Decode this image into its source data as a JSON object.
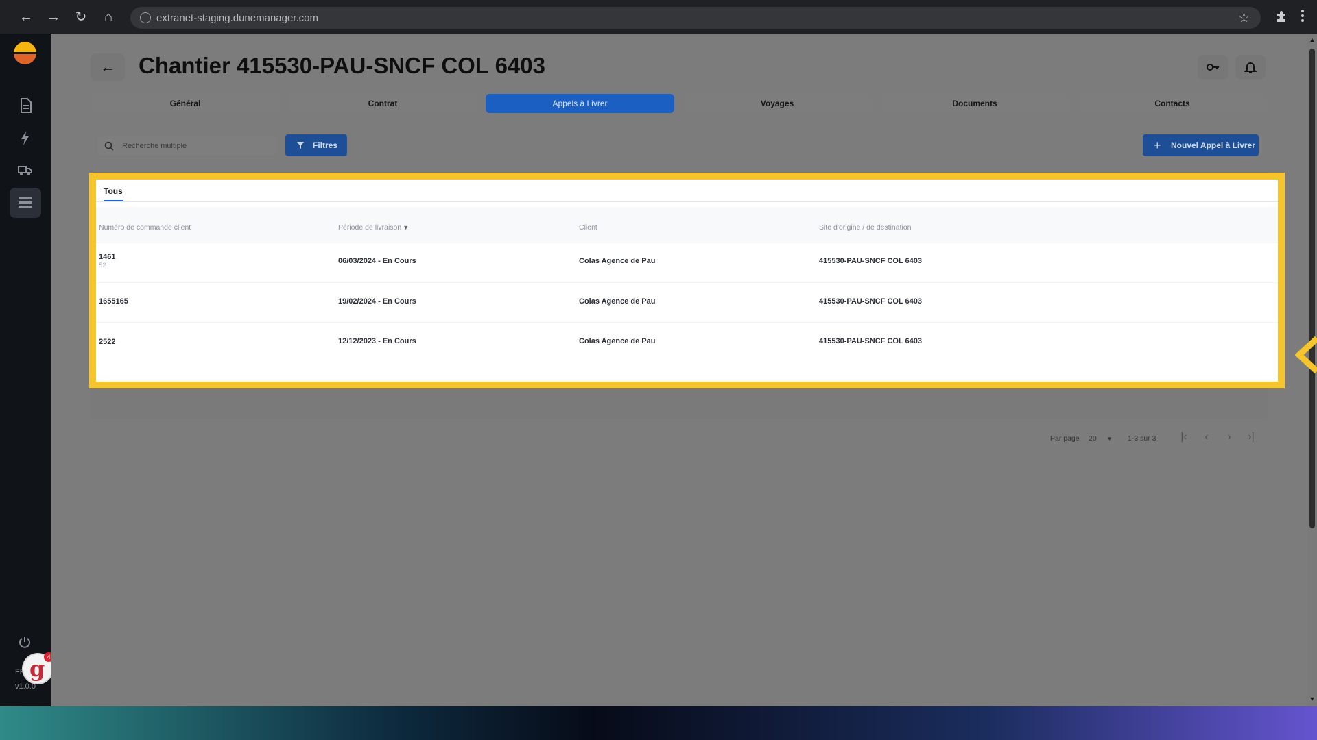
{
  "browser": {
    "url": "extranet-staging.dunemanager.com"
  },
  "sidebar": {
    "items": [
      {
        "name": "document-icon"
      },
      {
        "name": "lightning-icon"
      },
      {
        "name": "truck-icon"
      },
      {
        "name": "list-icon"
      }
    ],
    "footer_label": "FR",
    "version": "v1.0.0",
    "badge_count": "4"
  },
  "header": {
    "title": "Chantier 415530-PAU-SNCF COL 6403"
  },
  "tabs": [
    {
      "label": "Général"
    },
    {
      "label": "Contrat"
    },
    {
      "label": "Appels à Livrer"
    },
    {
      "label": "Voyages"
    },
    {
      "label": "Documents"
    },
    {
      "label": "Contacts"
    }
  ],
  "toolbar": {
    "search_placeholder": "Recherche multiple",
    "filter_label": "Filtres",
    "new_label": "Nouvel Appel à Livrer"
  },
  "table": {
    "tab": "Tous",
    "columns": [
      "Numéro de commande client",
      "Période de livraison",
      "Client",
      "Site d'origine / de destination"
    ],
    "rows": [
      {
        "order": "1461",
        "sub": "52",
        "period": "06/03/2024 - En Cours",
        "client": "Colas Agence de Pau",
        "site": "415530-PAU-SNCF COL 6403"
      },
      {
        "order": "1655165",
        "sub": "",
        "period": "19/02/2024 - En Cours",
        "client": "Colas Agence de Pau",
        "site": "415530-PAU-SNCF COL 6403"
      },
      {
        "order": "2522",
        "sub": "",
        "period": "12/12/2023 - En Cours",
        "client": "Colas Agence de Pau",
        "site": "415530-PAU-SNCF COL 6403"
      }
    ]
  },
  "pagination": {
    "per_page_label": "Par page",
    "per_page_value": "20",
    "range": "1-3 sur 3"
  },
  "colors": {
    "highlight": "#f6c42b",
    "primary": "#1b5fc2"
  }
}
